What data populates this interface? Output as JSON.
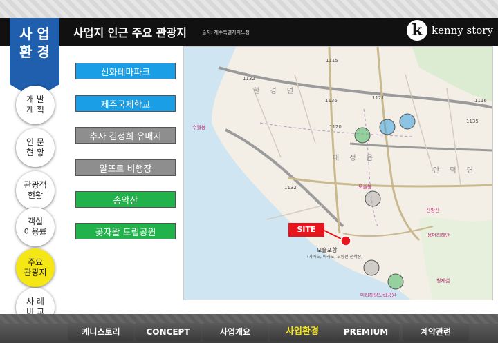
{
  "header": {
    "title": "사업지 인근 주요 관광지",
    "source": "출처: 제주특별자치도청",
    "brand_logo": "k",
    "brand_name": "kenny story"
  },
  "section_tag": {
    "line1": "사 업",
    "line2": "환 경",
    "color": "#1f5fae"
  },
  "left_nav": [
    {
      "label": "개 발\n계 획",
      "active": false
    },
    {
      "label": "인 문\n현 황",
      "active": false
    },
    {
      "label": "관광객\n현황",
      "active": false
    },
    {
      "label": "객실\n이용률",
      "active": false
    },
    {
      "label": "주요\n관광지",
      "active": true
    },
    {
      "label": "사 례\n비 교",
      "active": false
    }
  ],
  "attractions": [
    {
      "label": "신화테마파크",
      "color": "blue"
    },
    {
      "label": "제주국제학교",
      "color": "blue"
    },
    {
      "label": "추사 김정희 유배지",
      "color": "gray"
    },
    {
      "label": "알뜨르 비행장",
      "color": "gray"
    },
    {
      "label": "송악산",
      "color": "green"
    },
    {
      "label": "곶자왈 도립공원",
      "color": "green"
    }
  ],
  "map": {
    "site_label": "SITE",
    "port_label": "모슬포항",
    "port_sub": "(가파도, 마라도, 도항선 선착장)",
    "districts": [
      "한 경 면",
      "대 정 읍",
      "안 덕 면"
    ],
    "landmarks": [
      "수월봉",
      "모슬봉",
      "산방산",
      "형제섬",
      "용머리해안",
      "마라해양도립공원"
    ],
    "road_numbers": [
      "1115",
      "1132",
      "1121",
      "1116",
      "1136",
      "1120",
      "1135",
      "1132"
    ]
  },
  "bottom_nav": [
    {
      "label": "케니스토리",
      "active": false
    },
    {
      "label": "CONCEPT",
      "active": false
    },
    {
      "label": "사업개요",
      "active": false
    },
    {
      "label": "사업환경",
      "active": true
    },
    {
      "label": "PREMIUM",
      "active": false
    },
    {
      "label": "계약관련",
      "active": false
    }
  ],
  "colors": {
    "blue": "#1a9ee6",
    "gray": "#8e8e8e",
    "green": "#22b24c",
    "site": "#e8141e",
    "active": "#f5e616"
  }
}
